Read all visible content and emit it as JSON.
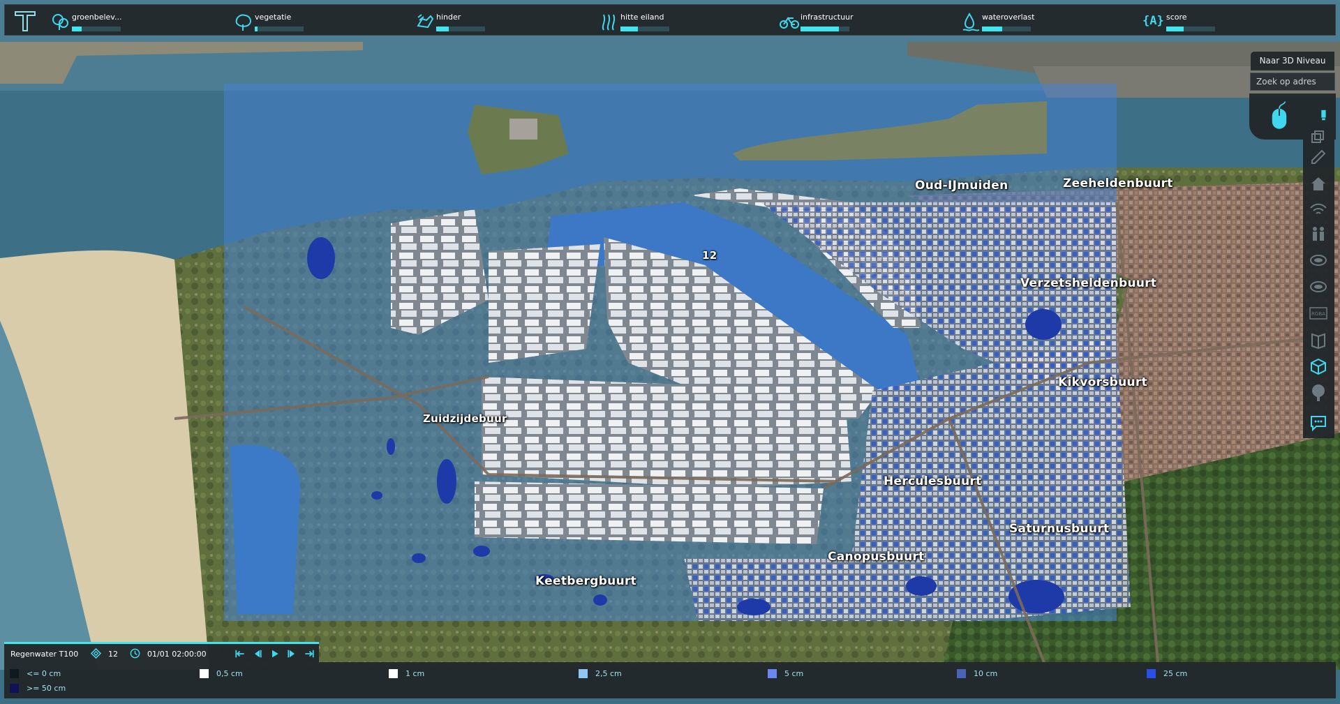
{
  "topbar": {
    "indicators": [
      {
        "label": "groenbelev...",
        "icon": "tree-icon",
        "progress": 0.2
      },
      {
        "label": "vegetatie",
        "icon": "bush-icon",
        "progress": 0.06
      },
      {
        "label": "hinder",
        "icon": "hand-shield-icon",
        "progress": 0.25
      },
      {
        "label": "hitte eiland",
        "icon": "heat-waves-icon",
        "progress": 0.35
      },
      {
        "label": "infrastructuur",
        "icon": "bicycle-icon",
        "progress": 0.78
      },
      {
        "label": "wateroverlast",
        "icon": "water-drop-icon",
        "progress": 0.42
      },
      {
        "label": "score",
        "icon": "score-icon",
        "progress": 0.35
      }
    ],
    "score_glyph": "{A}",
    "accent": "#3fe6ee"
  },
  "right_panel": {
    "to_3d_label": "Naar 3D Niveau",
    "address_placeholder": "Zoek op adres",
    "buttons": [
      "pin-icon",
      "layers-icon",
      "edit-icon",
      "house-icon",
      "wifi-icon",
      "people-icon",
      "overlay-icon",
      "overlay-2-icon",
      "rgba-icon",
      "book-icon",
      "cube-icon",
      "tree-icon",
      "chat-icon"
    ],
    "rgba_text": "RGBA"
  },
  "map": {
    "labels": [
      {
        "id": "oud-ijmuiden",
        "text": "Oud-IJmuiden"
      },
      {
        "id": "zeeheldenbuurt",
        "text": "Zeeheldenbuurt"
      },
      {
        "id": "verzetsheldenbuurt",
        "text": "Verzetsheldenbuurt"
      },
      {
        "id": "kikvorsbuurt",
        "text": "Kikvorsbuurt"
      },
      {
        "id": "zuidzijdebuurt",
        "text": "Zuidzijdebuur"
      },
      {
        "id": "herculesbuurt",
        "text": "Herculesbuurt"
      },
      {
        "id": "saturnusbuurt",
        "text": "Saturnusbuurt"
      },
      {
        "id": "canopusbuurt",
        "text": "Canopusbuurt"
      },
      {
        "id": "keetbergbuurt",
        "text": "Keetbergbuurt"
      },
      {
        "id": "marker-12",
        "text": "12"
      }
    ]
  },
  "timebar": {
    "overlay_name": "Regenwater T100",
    "layer_count": "12",
    "datetime": "01/01 02:00:00"
  },
  "legend": {
    "items": [
      {
        "label": "<= 0 cm",
        "color": "#0d1a22"
      },
      {
        "label": ">= 50 cm",
        "color": "#111155"
      },
      {
        "label": "0,5 cm",
        "color": "#ffffff"
      },
      {
        "label": "1 cm",
        "color": "#ffffff"
      },
      {
        "label": "2,5 cm",
        "color": "#8ec6f4"
      },
      {
        "label": "5 cm",
        "color": "#6a86f0"
      },
      {
        "label": "10 cm",
        "color": "#4a63b8"
      },
      {
        "label": "25 cm",
        "color": "#2b4fe6"
      }
    ]
  }
}
